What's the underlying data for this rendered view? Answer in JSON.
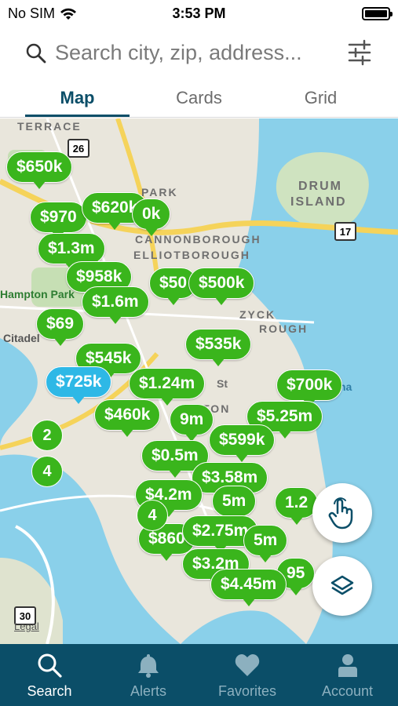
{
  "status_bar": {
    "carrier": "No SIM",
    "time": "3:53 PM"
  },
  "search": {
    "placeholder": "Search city, zip, address..."
  },
  "tabs": [
    {
      "label": "Map",
      "active": true
    },
    {
      "label": "Cards",
      "active": false
    },
    {
      "label": "Grid",
      "active": false
    }
  ],
  "map": {
    "labels": {
      "terrace": "TERRACE",
      "park": "PARK",
      "drum": "DRUM",
      "island": "ISLAND",
      "cannonborough": "CANNONBOROUGH",
      "elliotborough": "ELLIOTBOROUGH",
      "hampton_park": "Hampton Park",
      "citadel": "Citadel",
      "wagener": "ZYCK",
      "rough": "ROUGH",
      "ton": "TON",
      "st": "St",
      "na": "na"
    },
    "shields": {
      "r26": "26",
      "r17": "17",
      "r30": "30"
    },
    "legal": "Legal",
    "pins": [
      "$650k",
      "$970",
      "$620k",
      "0k",
      "$1.3m",
      "$958k",
      "$1.6m",
      "$50",
      "$500k",
      "$69",
      "$545k",
      "$535k",
      "$725k",
      "$1.24m",
      "$700k",
      "$460k",
      "9m",
      "$5.25m",
      "$599k",
      "$0.5m",
      "$3.58m",
      "$4.2m",
      "5m",
      "1.2",
      "$860",
      "$2.75m",
      "5m",
      "$3.2m",
      "95",
      "$4.45m"
    ],
    "clusters": [
      "2",
      "4",
      "4"
    ]
  },
  "bottom_nav": [
    {
      "label": "Search",
      "icon": "search-icon",
      "active": true
    },
    {
      "label": "Alerts",
      "icon": "bell-icon",
      "active": false
    },
    {
      "label": "Favorites",
      "icon": "heart-icon",
      "active": false
    },
    {
      "label": "Account",
      "icon": "person-icon",
      "active": false
    }
  ],
  "colors": {
    "brand": "#0b4e68",
    "pin_green": "#3ab51c",
    "pin_blue": "#2eb8e6",
    "water": "#8ad0ea"
  }
}
